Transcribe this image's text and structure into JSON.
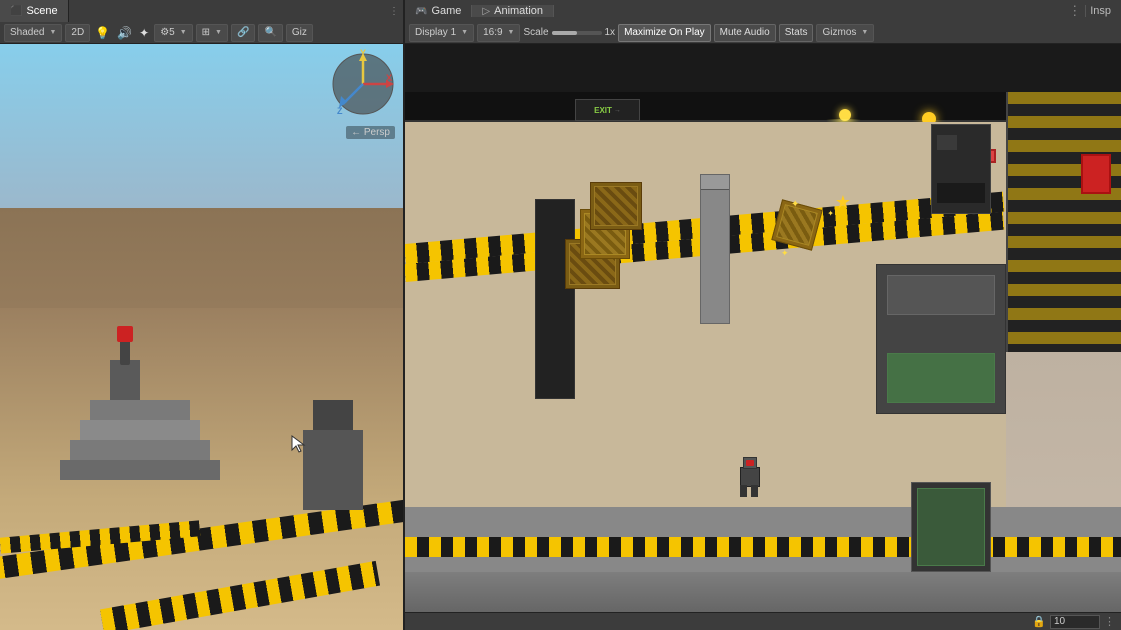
{
  "tabs": {
    "scene": {
      "label": "Scene",
      "active": false
    },
    "game": {
      "label": "Game",
      "active": false
    },
    "animation": {
      "label": "Animation",
      "active": false
    },
    "inspector": {
      "label": "Insp",
      "active": false
    }
  },
  "scene_toolbar": {
    "shading": "Shaded",
    "mode_2d": "2D",
    "scale_label": "1x",
    "scale_prefix": "Scale",
    "giz_label": "Giz",
    "persp_label": "← Persp"
  },
  "game_toolbar": {
    "display": "Display 1",
    "aspect": "16:9",
    "scale": "Scale",
    "scale_value": "1x",
    "maximize_on_play": "Maximize On Play",
    "mute_audio": "Mute Audio",
    "stats": "Stats",
    "gizmos": "Gizmos"
  },
  "bottom": {
    "input_value": "10"
  },
  "icons": {
    "scene_icon": "🎬",
    "game_icon": "🎮",
    "animation_icon": "🎞",
    "inspector_icon": "🔍",
    "more_icon": "⋮"
  }
}
